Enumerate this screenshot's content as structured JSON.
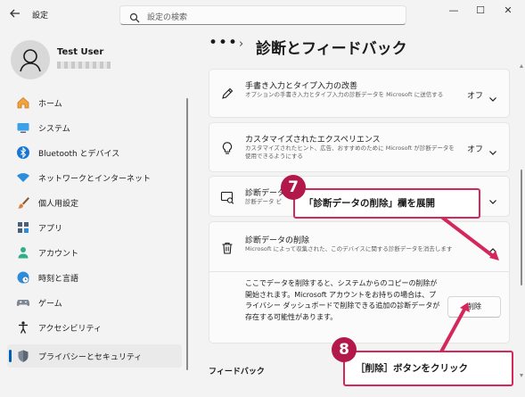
{
  "window": {
    "app_title": "設定",
    "search_placeholder": "設定の検索",
    "minimize": "—",
    "maximize": "☐",
    "close": "✕"
  },
  "user": {
    "name": "Test User"
  },
  "sidebar": {
    "items": [
      {
        "label": "ホーム",
        "icon": "home-icon"
      },
      {
        "label": "システム",
        "icon": "system-icon"
      },
      {
        "label": "Bluetooth とデバイス",
        "icon": "bluetooth-icon"
      },
      {
        "label": "ネットワークとインターネット",
        "icon": "wifi-icon"
      },
      {
        "label": "個人用設定",
        "icon": "brush-icon"
      },
      {
        "label": "アプリ",
        "icon": "apps-icon"
      },
      {
        "label": "アカウント",
        "icon": "account-icon"
      },
      {
        "label": "時刻と言語",
        "icon": "globe-clock-icon"
      },
      {
        "label": "ゲーム",
        "icon": "gamepad-icon"
      },
      {
        "label": "アクセシビリティ",
        "icon": "accessibility-icon"
      },
      {
        "label": "プライバシーとセキュリティ",
        "icon": "shield-icon",
        "active": true
      }
    ]
  },
  "breadcrumb": {
    "dots": "•••",
    "sep": "›",
    "title": "診断とフィードバック"
  },
  "cards": [
    {
      "title": "手書き入力とタイプ入力の改善",
      "desc": "オプションの手書き入力とタイプ入力の診断データを Microsoft に送信する",
      "status": "オフ",
      "icon": "pen-icon"
    },
    {
      "title": "カスタマイズされたエクスペリエンス",
      "desc": "カスタマイズされたヒント、広告、おすすめのために Microsoft が診断データを使用できるようにする",
      "status": "オフ",
      "icon": "lightbulb-icon"
    },
    {
      "title": "診断データ",
      "desc": "診断データ ビ",
      "icon": "data-view-icon"
    },
    {
      "title": "診断データの削除",
      "desc": "Microsoft によって収集された、このデバイスに関する診断データを消去します",
      "icon": "trash-icon"
    }
  ],
  "expanded": {
    "text": "ここでデータを削除すると、システムからのコピーの削除が開始されます。Microsoft アカウントをお持ちの場合は、プライバシー ダッシュボードで削除できる追加の診断データが存在する可能性があります。",
    "button": "削除"
  },
  "section_feedback": "フィードバック",
  "annotations": [
    {
      "number": "7",
      "text": "「診断データの削除」欄を展開"
    },
    {
      "number": "8",
      "text": "［削除］ボタンをクリック"
    }
  ],
  "colors": {
    "accent": "#005fb8",
    "annotation": "#d4275c",
    "badge": "#b3184a"
  }
}
